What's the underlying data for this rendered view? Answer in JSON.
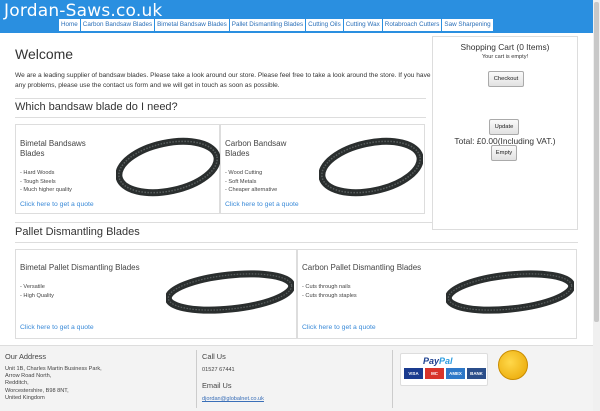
{
  "brand": "Jordan-Saws.co.uk",
  "nav": [
    "Home",
    "Carbon Bandsaw Blades",
    "Bimetal Bandsaw Blades",
    "Pallet Dismantling Blades",
    "Cutting Oils",
    "Cutting Wax",
    "Rotabroach Cutters",
    "Saw Sharpening"
  ],
  "welcome": {
    "title": "Welcome",
    "text": "We are a leading supplier of bandsaw blades. Please take a look around our store. Please feel free to take a look around the store. If you have any problems, please use the contact us form and we will get in touch as soon as possible."
  },
  "bandsaw_section": {
    "title": "Which bandsaw blade do I need?",
    "cards": [
      {
        "title_lines": [
          "Bimetal Bandsaws",
          "Blades"
        ],
        "features": [
          "- Hard Woods",
          "- Tough Steels",
          "- Much higher quality"
        ],
        "link": "Click here to get a quote"
      },
      {
        "title_lines": [
          "Carbon Bandsaw",
          "Blades"
        ],
        "features": [
          "- Wood Cutting",
          "- Soft Metals",
          "- Cheaper alternative"
        ],
        "link": "Click here to get a quote"
      }
    ]
  },
  "pallet_section": {
    "title": "Pallet Dismantling Blades",
    "cards": [
      {
        "title": "Bimetal Pallet Dismantling Blades",
        "features": [
          "- Versatile",
          "- High Quality"
        ],
        "link": "Click here to get a quote"
      },
      {
        "title": "Carbon Pallet Dismantling Blades",
        "features": [
          "- Cuts through nails",
          "- Cuts through staples"
        ],
        "link": "Click here to get a quote"
      }
    ]
  },
  "cart": {
    "title": "Shopping Cart (0 Items)",
    "empty_text": "Your cart is empty!",
    "checkout": "Checkout",
    "total": "Total: £0.00(Including VAT.)",
    "update": "Update",
    "empty_btn": "Empty"
  },
  "footer": {
    "address_title": "Our Address",
    "address_lines": [
      "Unit 1B, Charles Martin Business Park,",
      "Arrow Road North,",
      "Redditch,",
      "Worcestershire, B98 8NT,",
      "United Kingdom"
    ],
    "call_title": "Call Us",
    "phone": "01527 67441",
    "email_title": "Email Us",
    "email": "djordan@globalnet.co.uk",
    "paypal_pay": "Pay",
    "paypal_pal": "Pal",
    "card_logos": [
      "VISA",
      "MC",
      "AMEX",
      "BANK"
    ]
  },
  "colors": {
    "accent": "#2a8fe0",
    "link": "#3a8ad8"
  }
}
